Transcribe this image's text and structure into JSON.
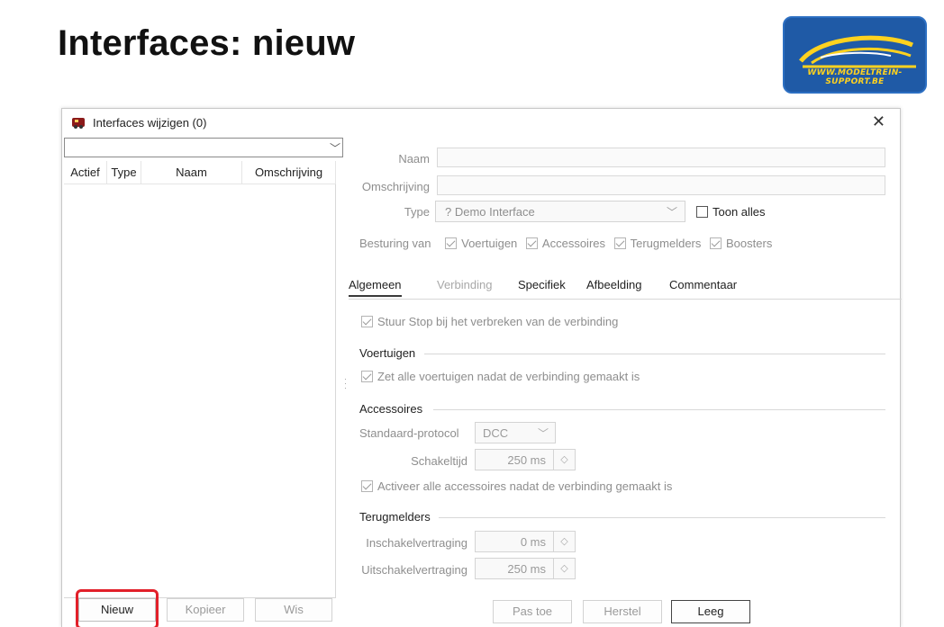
{
  "slide": {
    "title": "Interfaces: nieuw"
  },
  "logo": {
    "text": "WWW.MODELTREIN-SUPPORT.BE",
    "bg_color": "#1f5aa6",
    "accent_color": "#ffd21f"
  },
  "dialog": {
    "title": "Interfaces wijzigen (0)",
    "filter_value": "",
    "columns": [
      "Actief",
      "Type",
      "Naam",
      "Omschrijving"
    ],
    "buttons": {
      "new": "Nieuw",
      "copy": "Kopieer",
      "delete": "Wis",
      "apply": "Pas toe",
      "restore": "Herstel",
      "clear": "Leeg"
    },
    "form": {
      "name_label": "Naam",
      "name_value": "",
      "description_label": "Omschrijving",
      "description_value": "",
      "type_label": "Type",
      "type_value": "?  Demo Interface",
      "show_all_label": "Toon alles",
      "control_label": "Besturing van",
      "control_options": [
        "Voertuigen",
        "Accessoires",
        "Terugmelders",
        "Boosters"
      ]
    },
    "tabs": [
      "Algemeen",
      "Verbinding",
      "Specifiek",
      "Afbeelding",
      "Commentaar"
    ],
    "general": {
      "stop_on_disconnect": "Stuur Stop bij het verbreken van de verbinding",
      "vehicles_section": "Voertuigen",
      "vehicles_option": "Zet alle voertuigen nadat de verbinding gemaakt is",
      "accessories_section": "Accessoires",
      "protocol_label": "Standaard-protocol",
      "protocol_value": "DCC",
      "switch_time_label": "Schakeltijd",
      "switch_time_value": "250 ms",
      "accessories_option": "Activeer alle accessoires nadat de verbinding gemaakt is",
      "feedback_section": "Terugmelders",
      "on_delay_label": "Inschakelvertraging",
      "on_delay_value": "0 ms",
      "off_delay_label": "Uitschakelvertraging",
      "off_delay_value": "250 ms"
    }
  }
}
